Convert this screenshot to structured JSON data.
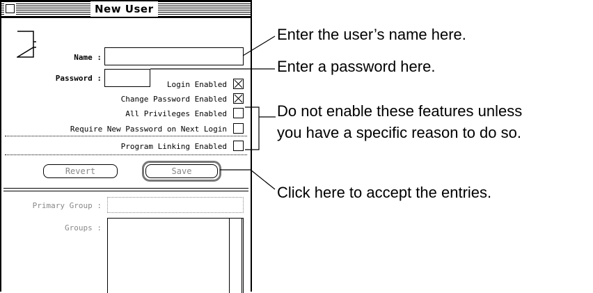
{
  "window": {
    "title": "New User",
    "name_label": "Name :",
    "name_value": "",
    "password_label": "Password :",
    "password_value": "",
    "checkboxes": [
      {
        "label": "Login Enabled",
        "checked": true
      },
      {
        "label": "Change Password Enabled",
        "checked": true
      },
      {
        "label": "All Privileges Enabled",
        "checked": false
      },
      {
        "label": "Require New Password on Next Login",
        "checked": false
      },
      {
        "label": "Program Linking Enabled",
        "checked": false
      }
    ],
    "revert_label": "Revert",
    "save_label": "Save",
    "primary_group_label": "Primary Group :",
    "primary_group_value": "",
    "groups_label": "Groups :"
  },
  "callouts": {
    "name": "Enter the user’s name here.",
    "password": "Enter a password here.",
    "features_line1": "Do not enable these features unless",
    "features_line2": "you have a specific reason to do so.",
    "save": "Click here to accept the entries."
  }
}
